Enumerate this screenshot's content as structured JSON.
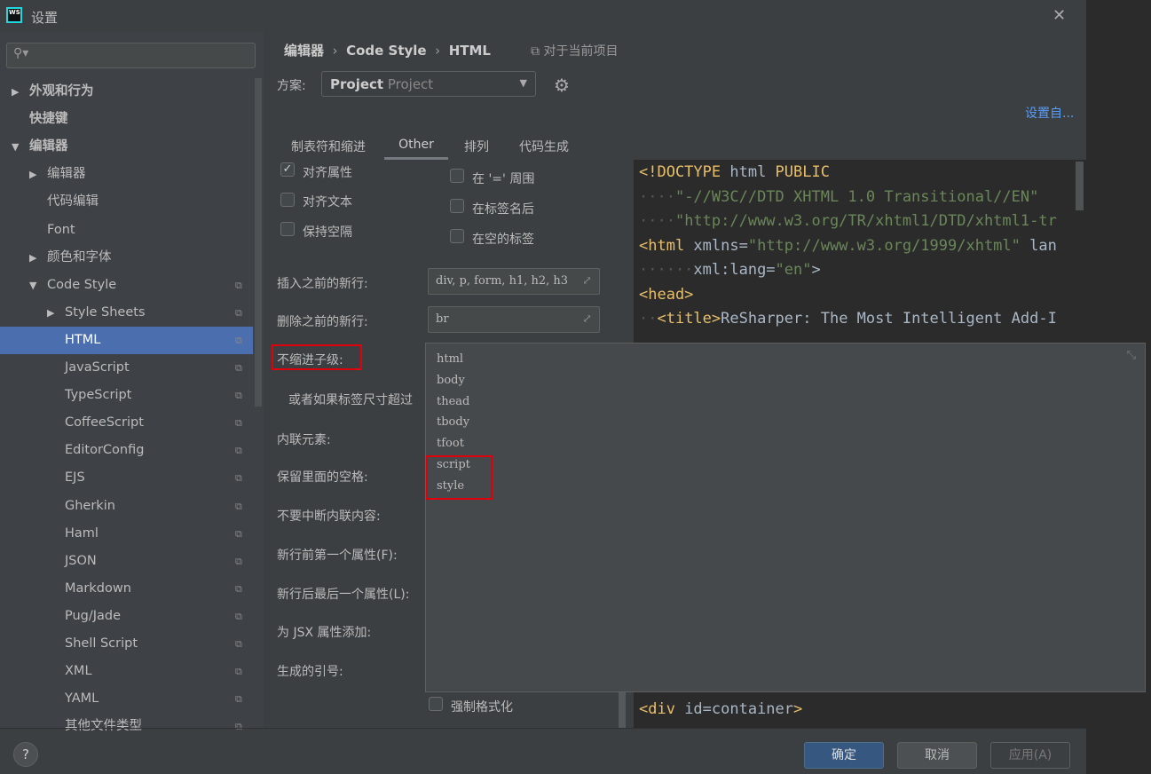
{
  "window": {
    "title": "设置",
    "close": "✕"
  },
  "sidebar": {
    "search_placeholder": "",
    "items": [
      {
        "label": "外观和行为",
        "arrow": "▶",
        "bold": true
      },
      {
        "label": "快捷键",
        "bold": true
      },
      {
        "label": "编辑器",
        "arrow": "▼",
        "bold": true
      },
      {
        "label": "编辑器",
        "arrow": "▶"
      },
      {
        "label": "代码编辑"
      },
      {
        "label": "Font"
      },
      {
        "label": "颜色和字体",
        "arrow": "▶"
      },
      {
        "label": "Code Style",
        "arrow": "▼"
      },
      {
        "label": "Style Sheets",
        "arrow": "▶"
      },
      {
        "label": "HTML",
        "selected": true
      },
      {
        "label": "JavaScript"
      },
      {
        "label": "TypeScript"
      },
      {
        "label": "CoffeeScript"
      },
      {
        "label": "EditorConfig"
      },
      {
        "label": "EJS"
      },
      {
        "label": "Gherkin"
      },
      {
        "label": "Haml"
      },
      {
        "label": "JSON"
      },
      {
        "label": "Markdown"
      },
      {
        "label": "Pug/Jade"
      },
      {
        "label": "Shell Script"
      },
      {
        "label": "XML"
      },
      {
        "label": "YAML"
      },
      {
        "label": "其他文件类型"
      }
    ]
  },
  "breadcrumb": {
    "items": [
      "编辑器",
      "Code Style",
      "HTML"
    ],
    "scope": "对于当前项目"
  },
  "scheme": {
    "label": "方案:",
    "value_bold": "Project",
    "value": "Project"
  },
  "set_from": "设置自...",
  "tabs": [
    "制表符和缩进",
    "Other",
    "排列",
    "代码生成"
  ],
  "active_tab": "Other",
  "checkboxes_left": [
    {
      "label": "对齐属性",
      "checked": true
    },
    {
      "label": "对齐文本",
      "checked": false
    },
    {
      "label": "保持空隔",
      "checked": false
    }
  ],
  "checkboxes_right": [
    {
      "label": "在 '=' 周围",
      "checked": false
    },
    {
      "label": "在标签名后",
      "checked": false
    },
    {
      "label": "在空的标签",
      "checked": false
    }
  ],
  "fields": {
    "insert_before_label": "插入之前的新行:",
    "insert_before_value": "div, p, form, h1, h2, h3",
    "remove_before_label": "删除之前的新行:",
    "remove_before_value": "br",
    "no_indent_label": "不缩进子级:",
    "or_if_label": "或者如果标签尺寸超过",
    "inline_label": "内联元素:",
    "keep_ws_label": "保留里面的空格:",
    "dont_break_label": "不要中断内联内容:",
    "first_attr_label": "新行前第一个属性(F):",
    "last_attr_label": "新行后最后一个属性(L):",
    "jsx_label": "为 JSX 属性添加:",
    "quotes_label": "生成的引号:",
    "force_format_label": "强制格式化"
  },
  "popup": {
    "items": [
      "html",
      "body",
      "thead",
      "tbody",
      "tfoot",
      "script",
      "style"
    ]
  },
  "preview": {
    "line1a": "<!DOCTYPE",
    "line1b": " html ",
    "line1c": "PUBLIC",
    "line2": "\"-//W3C//DTD XHTML 1.0 Transitional//EN\"",
    "line3": "\"http://www.w3.org/TR/xhtml1/DTD/xhtml1-tr",
    "line4a": "<html",
    "line4b": " xmlns=",
    "line4c": "\"http://www.w3.org/1999/xhtml\"",
    "line4d": " lan",
    "line5a": "xml:lang=",
    "line5b": "\"en\"",
    "line5c": ">",
    "line6": "<head>",
    "line7a": "<title>",
    "line7b": "ReSharper: The Most Intelligent Add-I",
    "last_a": "<div",
    "last_b": " id=container",
    "last_c": ">"
  },
  "buttons": {
    "ok": "确定",
    "cancel": "取消",
    "apply": "应用(A)",
    "help": "?"
  }
}
